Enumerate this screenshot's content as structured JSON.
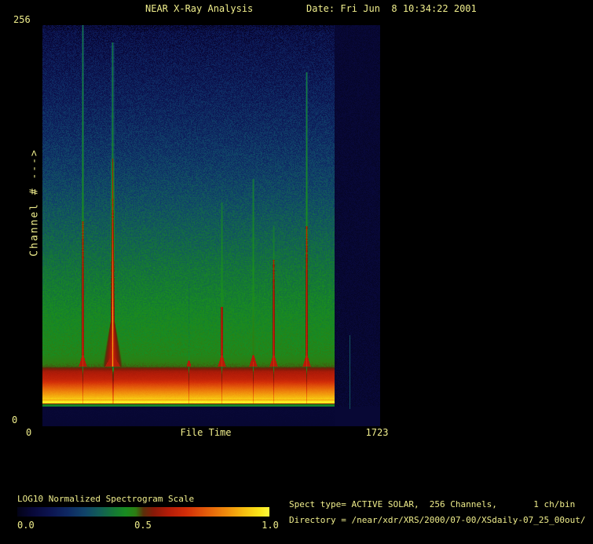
{
  "header": {
    "title": "NEAR X-Ray Analysis",
    "date_label": "Date: Fri Jun  8 10:34:22 2001"
  },
  "axes": {
    "y_max": "256",
    "y_min": "0",
    "y_label": "Channel # --->",
    "x_min": "0",
    "x_label": "File Time",
    "x_max": "1723"
  },
  "colorbar": {
    "title": "LOG10 Normalized Spectrogram Scale",
    "tick_labels": [
      "0.0",
      "0.5",
      "1.0"
    ]
  },
  "info": {
    "spect_line": "Spect type= ACTIVE SOLAR,  256 Channels,       1 ch/bin",
    "directory_line": "Directory = /near/xdr/XRS/2000/07-00/XSdaily-07_25_00out/"
  },
  "colors": {
    "background": "#000000",
    "text": "#f0ee8c",
    "plot_empty_navy": "#070735"
  },
  "chart_data": {
    "type": "heatmap",
    "title": "NEAR X-Ray Analysis",
    "xlabel": "File Time",
    "ylabel": "Channel #",
    "xlim": [
      0,
      1723
    ],
    "ylim": [
      0,
      256
    ],
    "grid": false,
    "legend_position": "bottom-left-colorbar",
    "scale_label": "LOG10 Normalized Spectrogram Scale",
    "scale_ticks": [
      0.0,
      0.5,
      1.0
    ],
    "data_extent_time": 1490,
    "noise_seed": 1234,
    "colormap_stops": [
      [
        0.0,
        [
          3,
          3,
          22
        ]
      ],
      [
        0.06,
        [
          8,
          8,
          56
        ]
      ],
      [
        0.13,
        [
          12,
          20,
          80
        ]
      ],
      [
        0.2,
        [
          14,
          40,
          98
        ]
      ],
      [
        0.27,
        [
          16,
          68,
          105
        ]
      ],
      [
        0.33,
        [
          18,
          95,
          85
        ]
      ],
      [
        0.38,
        [
          20,
          118,
          55
        ]
      ],
      [
        0.43,
        [
          24,
          140,
          32
        ]
      ],
      [
        0.47,
        [
          45,
          125,
          18
        ]
      ],
      [
        0.5,
        [
          90,
          48,
          10
        ]
      ],
      [
        0.54,
        [
          135,
          25,
          8
        ]
      ],
      [
        0.6,
        [
          180,
          28,
          8
        ]
      ],
      [
        0.67,
        [
          210,
          45,
          8
        ]
      ],
      [
        0.75,
        [
          228,
          92,
          10
        ]
      ],
      [
        0.83,
        [
          240,
          140,
          12
        ]
      ],
      [
        0.9,
        [
          246,
          190,
          16
        ]
      ],
      [
        0.96,
        [
          250,
          228,
          24
        ]
      ],
      [
        1.0,
        [
          252,
          248,
          60
        ]
      ]
    ],
    "background_profile": [
      [
        256,
        0.095
      ],
      [
        225,
        0.145
      ],
      [
        190,
        0.205
      ],
      [
        160,
        0.26
      ],
      [
        130,
        0.32
      ],
      [
        100,
        0.375
      ],
      [
        70,
        0.42
      ],
      [
        45,
        0.45
      ],
      [
        38,
        0.48
      ],
      [
        35,
        0.58
      ],
      [
        30,
        0.63
      ],
      [
        27,
        0.7
      ],
      [
        22,
        0.82
      ],
      [
        18,
        0.9
      ],
      [
        17,
        0.93
      ],
      [
        16.6,
        0.8
      ],
      [
        16.2,
        0.97
      ],
      [
        14.6,
        0.97
      ],
      [
        14.2,
        0.42
      ],
      [
        12.8,
        0.42
      ],
      [
        12.4,
        0.055
      ],
      [
        0,
        0.05
      ]
    ],
    "bands": {
      "red_top_ch": 38,
      "orange_top_ch": 27,
      "bright_yellow_bottom_ch": 14.6,
      "green_line_ch": 13.5,
      "empty_below_ch": 12.4
    },
    "flares": [
      {
        "time": 204,
        "ch_top": 256,
        "ch_red": 131
      },
      {
        "time": 357,
        "ch_top": 245,
        "ch_red": 171,
        "cone": true,
        "cone_top_ch": 75
      },
      {
        "time": 745,
        "ch_top": 91,
        "ch_red": 20,
        "weak": true
      },
      {
        "time": 914,
        "ch_top": 143,
        "ch_red": 76
      },
      {
        "time": 1074,
        "ch_top": 158,
        "ch_red": 41
      },
      {
        "time": 1178,
        "ch_top": 128,
        "ch_red": 106
      },
      {
        "time": 1346,
        "ch_top": 226,
        "ch_red": 128
      }
    ],
    "artifact_line": {
      "time": 1567,
      "ch_range": [
        11,
        58
      ]
    }
  }
}
